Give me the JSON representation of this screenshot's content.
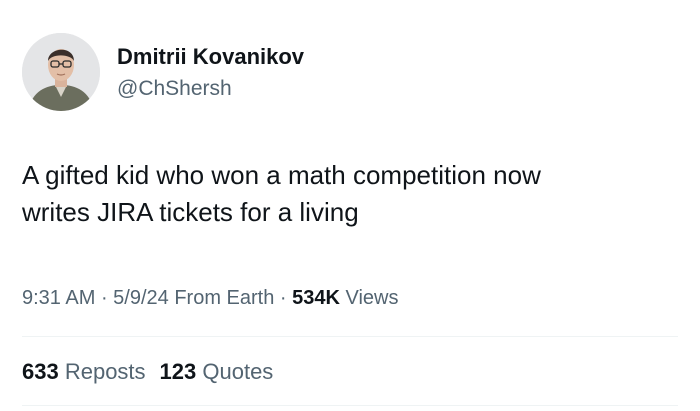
{
  "author": {
    "name": "Dmitrii Kovanikov",
    "handle": "@ChShersh"
  },
  "tweet": {
    "lines": [
      "A gifted kid who won a math competition now",
      "writes JIRA tickets for a living"
    ]
  },
  "meta": {
    "time": "9:31 AM",
    "sep1": " · ",
    "date": "5/9/24",
    "source": " From Earth",
    "sep2": " · ",
    "views_count": "534K",
    "views_label": " Views"
  },
  "stats": {
    "reposts_count": "633",
    "reposts_label": " Reposts",
    "quotes_count": "123",
    "quotes_label": " Quotes"
  }
}
